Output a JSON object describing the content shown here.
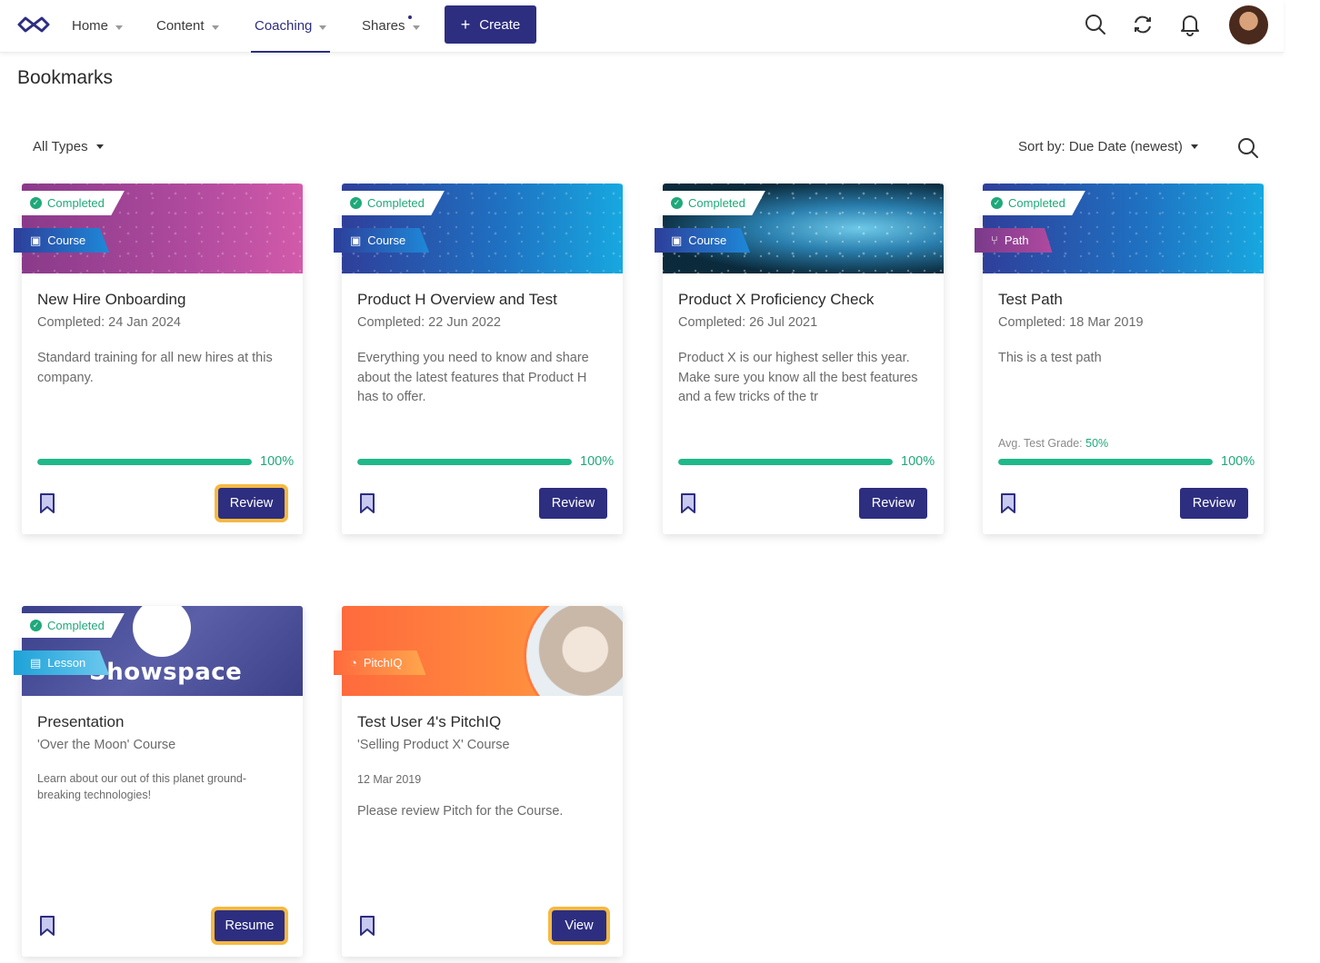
{
  "nav": {
    "home": "Home",
    "content": "Content",
    "coaching": "Coaching",
    "shares": "Shares",
    "create": "Create"
  },
  "page": {
    "title": "Bookmarks"
  },
  "filters": {
    "type": "All Types",
    "sort": "Sort by: Due Date (newest)"
  },
  "colors": {
    "primary": "#2d2e80",
    "success": "#1fa97a",
    "focus": "#f5b942"
  },
  "cards": [
    {
      "status": "Completed",
      "type": "Course",
      "title": "New Hire Onboarding",
      "subtitle": "Completed: 24 Jan 2024",
      "description": "Standard training for all new hires at this company.",
      "progress_pct": 100,
      "progress_label": "100%",
      "button": "Review"
    },
    {
      "status": "Completed",
      "type": "Course",
      "title": "Product H Overview and Test",
      "subtitle": "Completed: 22 Jun 2022",
      "description": "Everything you need to know and share about the latest features that Product H has to offer.",
      "progress_pct": 100,
      "progress_label": "100%",
      "button": "Review"
    },
    {
      "status": "Completed",
      "type": "Course",
      "title": "Product X Proficiency Check",
      "subtitle": "Completed: 26 Jul 2021",
      "description": "Product X is our highest seller this year. Make sure you know all the best features and a few tricks of the tr",
      "progress_pct": 100,
      "progress_label": "100%",
      "button": "Review"
    },
    {
      "status": "Completed",
      "type": "Path",
      "title": "Test Path",
      "subtitle": "Completed: 18 Mar 2019",
      "description": "This is a test path",
      "avg_label": "Avg. Test Grade:",
      "avg_value": "50%",
      "progress_pct": 100,
      "progress_label": "100%",
      "button": "Review"
    },
    {
      "status": "Completed",
      "type": "Lesson",
      "banner_text": "Showspace",
      "title": "Presentation",
      "subtitle": "'Over the Moon' Course",
      "description": "Learn about our out of this planet ground-breaking technologies!",
      "button": "Resume"
    },
    {
      "type": "PitchIQ",
      "title": "Test User 4's PitchIQ",
      "subtitle": "'Selling Product X' Course",
      "date": "12 Mar 2019",
      "description": "Please review Pitch for the Course.",
      "button": "View"
    }
  ]
}
